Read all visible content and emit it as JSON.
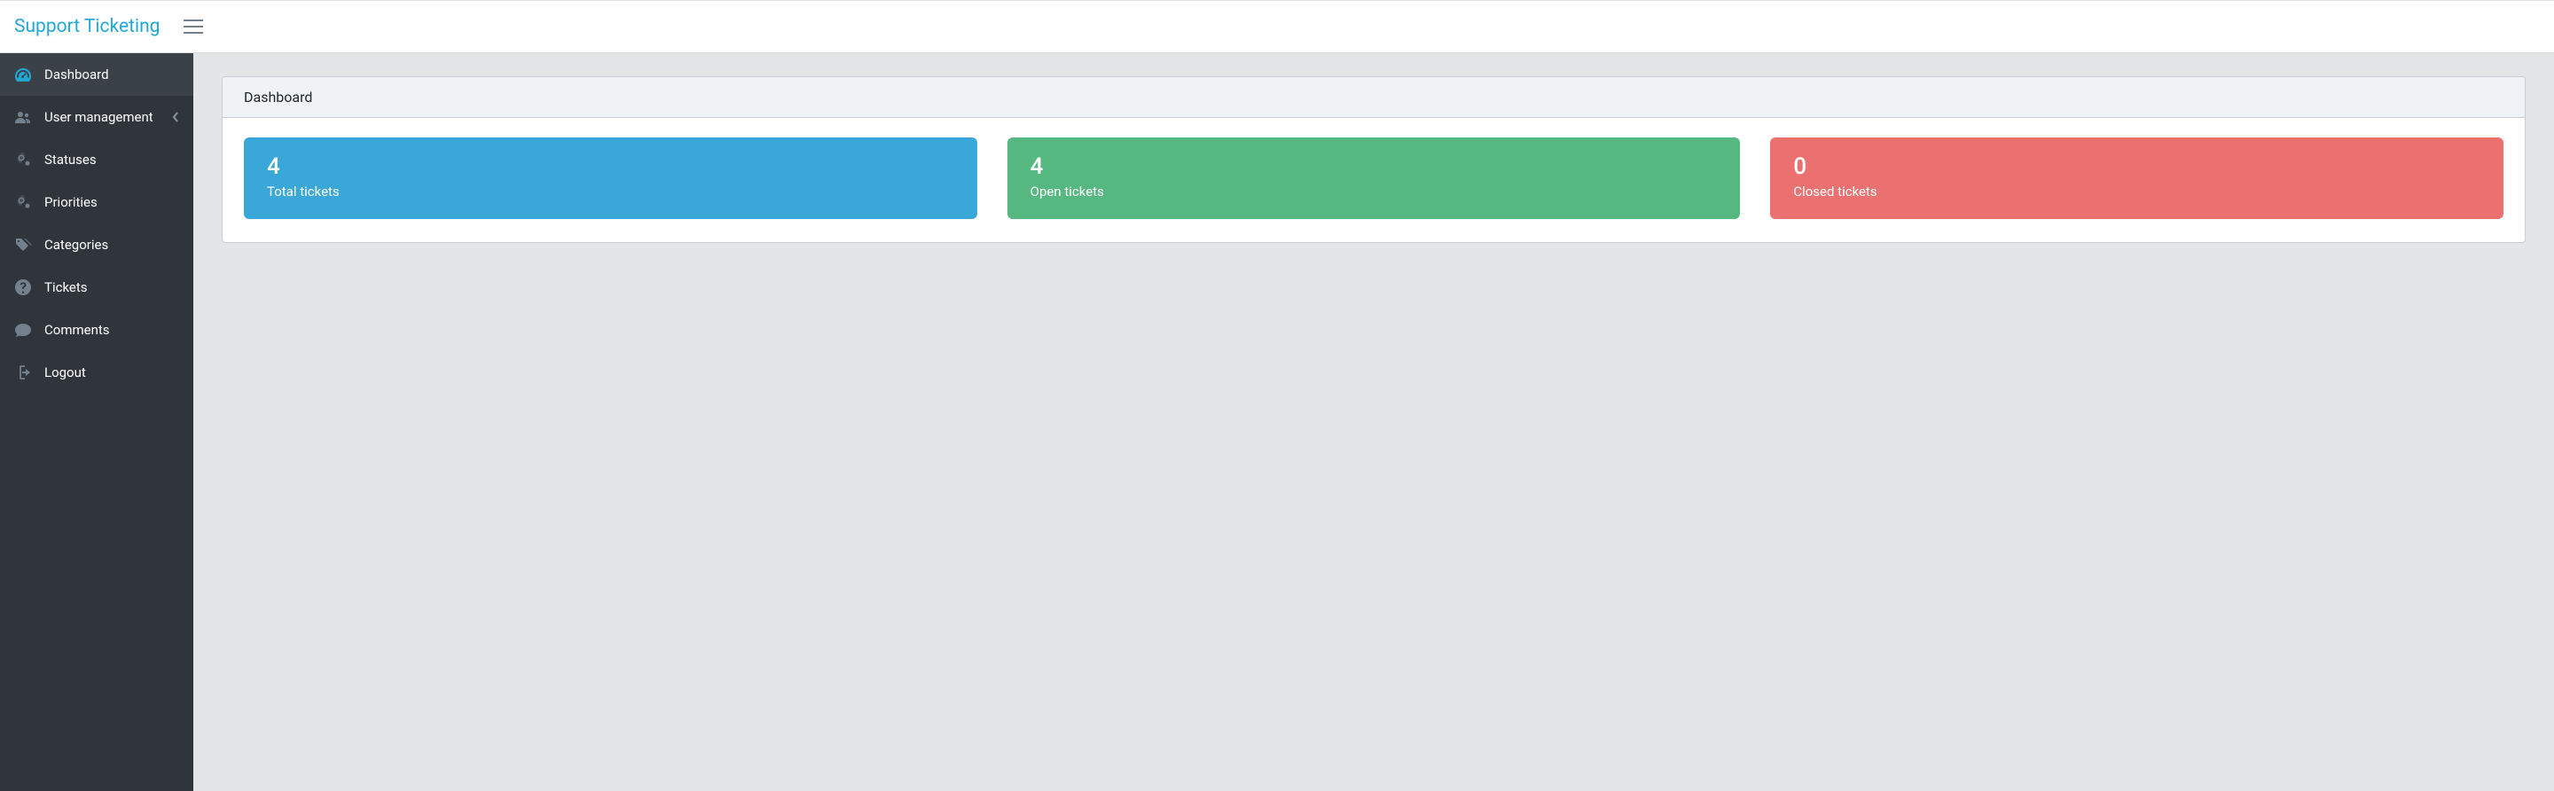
{
  "brand": "Support Ticketing",
  "sidebar": {
    "items": [
      {
        "label": "Dashboard"
      },
      {
        "label": "User management"
      },
      {
        "label": "Statuses"
      },
      {
        "label": "Priorities"
      },
      {
        "label": "Categories"
      },
      {
        "label": "Tickets"
      },
      {
        "label": "Comments"
      },
      {
        "label": "Logout"
      }
    ]
  },
  "page": {
    "title": "Dashboard"
  },
  "stats": [
    {
      "value": "4",
      "label": "Total tickets"
    },
    {
      "value": "4",
      "label": "Open tickets"
    },
    {
      "value": "0",
      "label": "Closed tickets"
    }
  ]
}
